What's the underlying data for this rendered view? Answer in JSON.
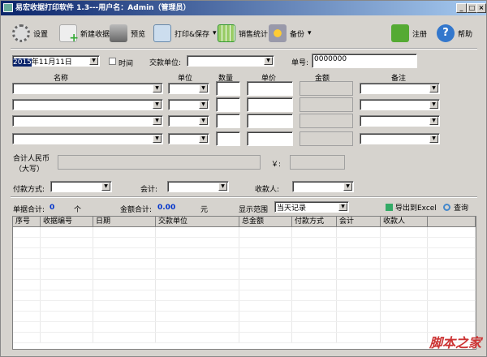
{
  "window": {
    "title": "易宏收据打印软件 1.3---用户名：Admin（管理员）",
    "min": "_",
    "max": "□",
    "close": "×"
  },
  "toolbar": {
    "settings": "设置",
    "new_receipt": "新建收据",
    "preview": "预览",
    "print_save": "打印&保存",
    "sales_stats": "销售统计",
    "backup": "备份",
    "register": "注册",
    "help": "帮助",
    "dropdown_arrow": "▾"
  },
  "form": {
    "date_year": "2015",
    "date_rest": "年11月11日",
    "time_label": "时间",
    "payer_label": "交款单位:",
    "number_label": "单号:",
    "number_value": "0000000",
    "col_name": "名称",
    "col_unit": "单位",
    "col_qty": "数量",
    "col_price": "单价",
    "col_amount": "金额",
    "col_note": "备注",
    "total_rmb_label": "合计人民币",
    "total_rmb_label2": "（大写）",
    "yen_label": "￥:",
    "payment_label": "付款方式:",
    "accountant_label": "会计:",
    "payee_label": "收款人:",
    "arrow": "▼"
  },
  "summary": {
    "count_label": "单据合计:",
    "count_value": "0",
    "count_unit": "个",
    "amount_label": "金额合计:",
    "amount_value": "0.00",
    "amount_unit": "元",
    "range_label": "显示范围",
    "range_value": "当天记录",
    "export": "导出到Excel",
    "query": "查询"
  },
  "grid": {
    "columns": [
      "序号",
      "收据编号",
      "日期",
      "交款单位",
      "总金额",
      "付款方式",
      "会计",
      "收款人",
      ""
    ]
  },
  "watermark": "脚本之家"
}
